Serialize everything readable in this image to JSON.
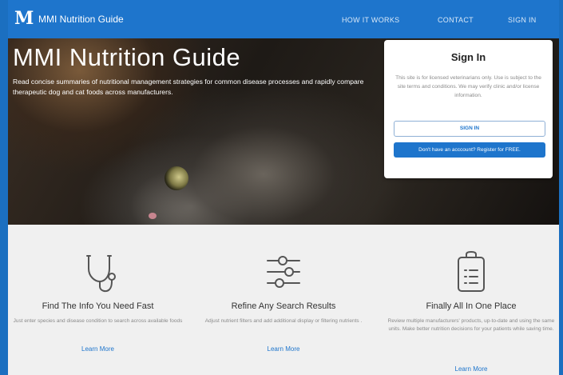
{
  "nav": {
    "logo_letter": "M",
    "brand": "MMI Nutrition Guide",
    "links": [
      "HOW IT WORKS",
      "CONTACT",
      "SIGN IN"
    ]
  },
  "hero": {
    "title": "MMI Nutrition Guide",
    "description": "Read concise summaries of nutritional management strategies for common disease processes and rapidly compare therapeutic dog and cat foods across manufacturers."
  },
  "signin": {
    "title": "Sign In",
    "notice": "This site is for licensed veterinarians only. Use is subject to the site terms and conditions. We may verify clinic and/or license information.",
    "signin_button": "SIGN IN",
    "register_button": "Don't have an acccount? Register for FREE."
  },
  "features": [
    {
      "icon": "stethoscope-icon",
      "title": "Find The Info You Need Fast",
      "description": "Just enter species and disease condition to search across available foods",
      "link": "Learn More"
    },
    {
      "icon": "sliders-icon",
      "title": "Refine Any Search Results",
      "description": "Adjust nutrient filters and add additional display or filtering nutrients .",
      "link": "Learn More"
    },
    {
      "icon": "clipboard-icon",
      "title": "Finally All In One Place",
      "description": "Review multiple manufacturers' products, up-to-date and using the same units. Make better nutrition decisions for your patients while saving time.",
      "link": "Learn More"
    }
  ],
  "colors": {
    "brand_blue": "#1e75cc",
    "page_background": "#f0f0f0",
    "muted_text": "#8a8a8a"
  }
}
